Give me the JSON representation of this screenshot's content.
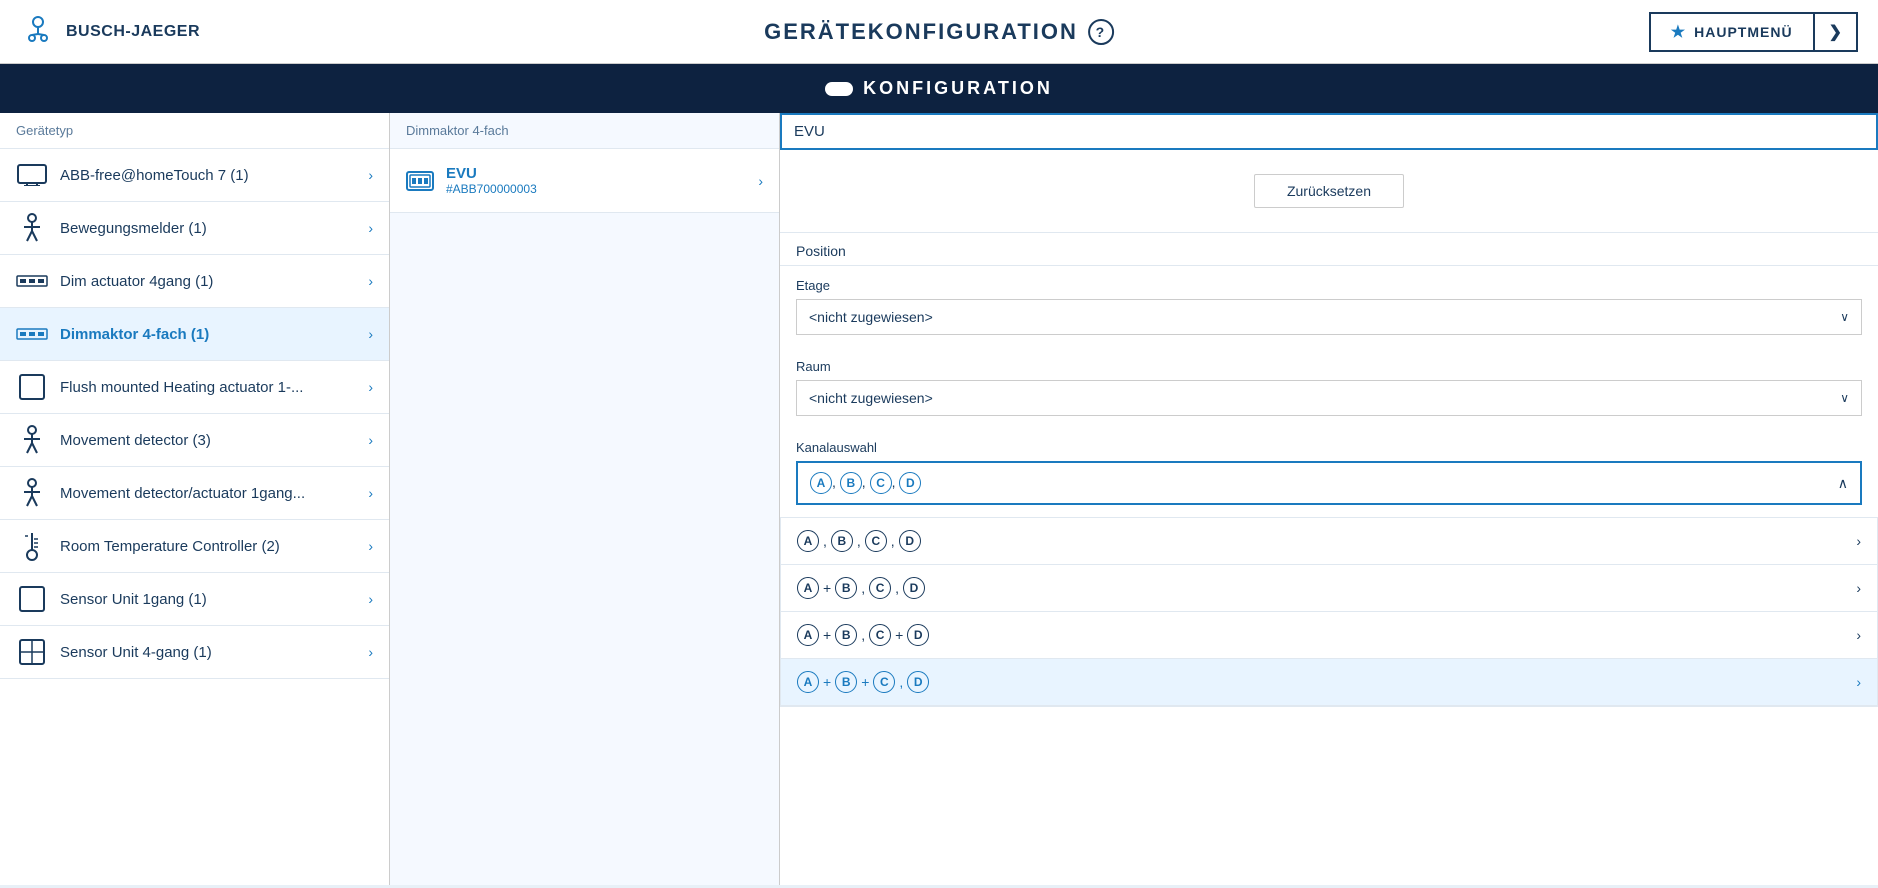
{
  "header": {
    "logo_text": "BUSCH-JAEGER",
    "title": "GERÄTEKONFIGURATION",
    "help_label": "?",
    "hauptmenu_label": "HAUPTMENÜ",
    "expand_label": "❯",
    "star": "★"
  },
  "konfig_bar": {
    "label": "KONFIGURATION"
  },
  "left_panel": {
    "header": "Gerätetyp",
    "items": [
      {
        "id": "abb-free",
        "label": "ABB-free@homeTouch 7 (1)",
        "icon": "monitor"
      },
      {
        "id": "bewegungsmelder",
        "label": "Bewegungsmelder (1)",
        "icon": "motion"
      },
      {
        "id": "dim-actuator",
        "label": "Dim actuator 4gang (1)",
        "icon": "dimmer"
      },
      {
        "id": "dimmaktor",
        "label": "Dimmaktor 4-fach (1)",
        "icon": "dimmer",
        "active": true
      },
      {
        "id": "flush-heating",
        "label": "Flush mounted Heating actuator 1-...",
        "icon": "square"
      },
      {
        "id": "movement-detector",
        "label": "Movement detector (3)",
        "icon": "motion"
      },
      {
        "id": "movement-actuator",
        "label": "Movement detector/actuator 1gang...",
        "icon": "motion"
      },
      {
        "id": "room-temp",
        "label": "Room Temperature Controller (2)",
        "icon": "thermometer"
      },
      {
        "id": "sensor-1gang",
        "label": "Sensor Unit 1gang (1)",
        "icon": "square"
      },
      {
        "id": "sensor-4gang",
        "label": "Sensor Unit 4-gang (1)",
        "icon": "grid"
      }
    ]
  },
  "middle_panel": {
    "header": "Dimmaktor 4-fach",
    "items": [
      {
        "name": "EVU",
        "id": "#ABB700000003",
        "icon": "dimmer"
      }
    ]
  },
  "right_panel": {
    "search_placeholder": "EVU",
    "reset_button": "Zurücksetzen",
    "position_label": "Position",
    "etage_label": "Etage",
    "etage_value": "<nicht zugewiesen>",
    "raum_label": "Raum",
    "raum_value": "<nicht zugewiesen>",
    "kanal_label": "Kanalauswahl",
    "kanal_selected": "A, B, C, D",
    "kanal_options": [
      {
        "text": "A, B, C, D",
        "channels": [
          "A",
          "B",
          "C",
          "D"
        ],
        "separator": []
      },
      {
        "text": "A+B, C,D",
        "channels": [
          "A+B",
          "C",
          "D"
        ],
        "separator": [
          "+"
        ]
      },
      {
        "text": "A+B, C+D",
        "channels": [
          "A+B",
          "C+D"
        ],
        "separator": [
          "+",
          "+"
        ]
      },
      {
        "text": "A+B+C, D",
        "channels": [
          "A+B+C",
          "D"
        ],
        "highlighted": true
      }
    ]
  }
}
